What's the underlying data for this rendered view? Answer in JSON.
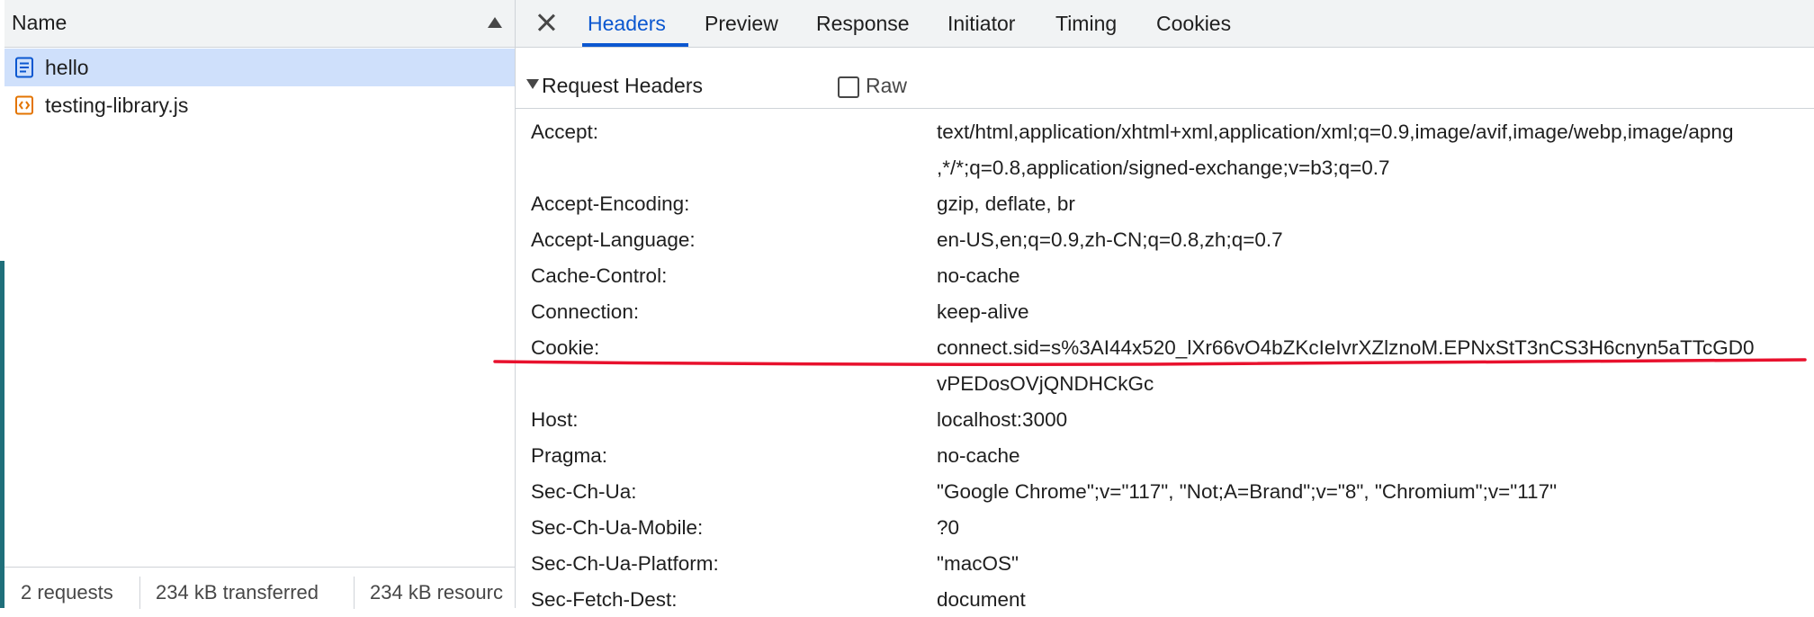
{
  "colors": {
    "accent": "#0b57d0",
    "selected_row": "#cfe0fb",
    "annotation": "#e8112d"
  },
  "request_list": {
    "header_label": "Name",
    "requests": [
      {
        "name": "hello",
        "icon": "document-icon",
        "selected": true
      },
      {
        "name": "testing-library.js",
        "icon": "script-icon",
        "selected": false
      }
    ],
    "status": {
      "requests": "2 requests",
      "transferred": "234 kB transferred",
      "resources": "234 kB resourc"
    }
  },
  "details": {
    "tabs": [
      "Headers",
      "Preview",
      "Response",
      "Initiator",
      "Timing",
      "Cookies"
    ],
    "active_tab": "Headers",
    "section_title": "Request Headers",
    "raw_label": "Raw",
    "headers": [
      {
        "key": "Accept:",
        "value": "text/html,application/xhtml+xml,application/xml;q=0.9,image/avif,image/webp,image/apng"
      },
      {
        "key": "",
        "value": ",*/*;q=0.8,application/signed-exchange;v=b3;q=0.7"
      },
      {
        "key": "Accept-Encoding:",
        "value": "gzip, deflate, br"
      },
      {
        "key": "Accept-Language:",
        "value": "en-US,en;q=0.9,zh-CN;q=0.8,zh;q=0.7"
      },
      {
        "key": "Cache-Control:",
        "value": "no-cache"
      },
      {
        "key": "Connection:",
        "value": "keep-alive"
      },
      {
        "key": "Cookie:",
        "value": "connect.sid=s%3AI44x520_lXr66vO4bZKcIeIvrXZlznoM.EPNxStT3nCS3H6cnyn5aTTcGD0"
      },
      {
        "key": "",
        "value": "vPEDosOVjQNDHCkGc"
      },
      {
        "key": "Host:",
        "value": "localhost:3000"
      },
      {
        "key": "Pragma:",
        "value": "no-cache"
      },
      {
        "key": "Sec-Ch-Ua:",
        "value": "\"Google Chrome\";v=\"117\", \"Not;A=Brand\";v=\"8\", \"Chromium\";v=\"117\""
      },
      {
        "key": "Sec-Ch-Ua-Mobile:",
        "value": "?0"
      },
      {
        "key": "Sec-Ch-Ua-Platform:",
        "value": "\"macOS\""
      },
      {
        "key": "Sec-Fetch-Dest:",
        "value": "document"
      }
    ]
  }
}
